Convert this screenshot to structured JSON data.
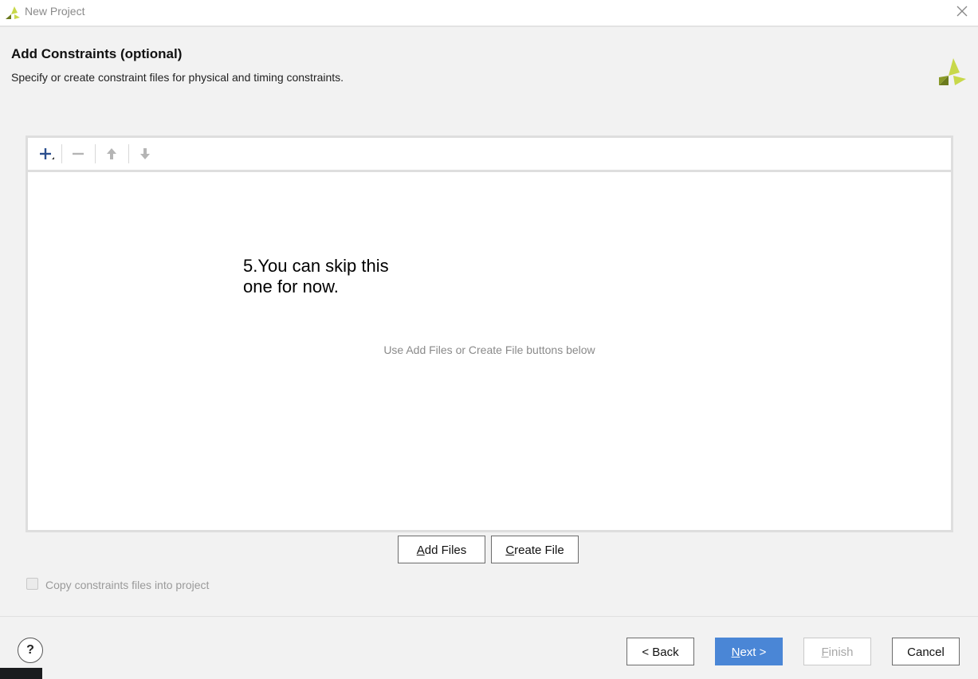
{
  "window": {
    "title": "New Project"
  },
  "header": {
    "title": "Add Constraints (optional)",
    "subtitle": "Specify or create constraint files for physical and timing constraints."
  },
  "toolbar": {
    "icons": [
      "add-icon",
      "remove-icon",
      "move-up-icon",
      "move-down-icon"
    ]
  },
  "file_list": {
    "empty_hint": "Use Add Files or Create File buttons below"
  },
  "annotation": {
    "line1": "5.You can skip this",
    "line2": "one for now."
  },
  "buttons": {
    "add_files": {
      "mnemonic": "A",
      "rest": "dd Files"
    },
    "create_file": {
      "mnemonic": "C",
      "rest": "reate File"
    },
    "back": "< Back",
    "next": {
      "mnemonic": "N",
      "rest": "ext >"
    },
    "finish": {
      "mnemonic": "F",
      "rest": "inish"
    },
    "cancel": "Cancel",
    "help": "?"
  },
  "copy_constraints": {
    "label": "Copy constraints files into project",
    "checked": false
  },
  "colors": {
    "accent": "#4a86d6",
    "brand_light": "#c8d84a",
    "brand_dark": "#6b7a1e"
  }
}
